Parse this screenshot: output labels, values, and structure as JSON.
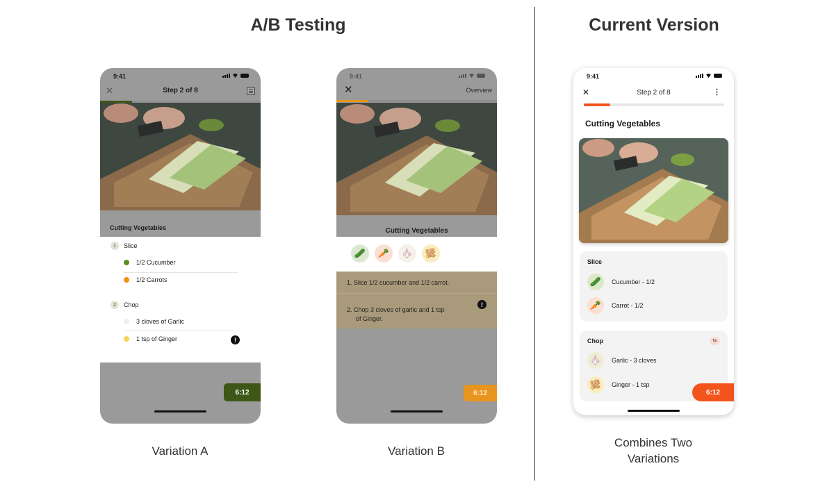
{
  "headings": {
    "ab": "A/B Testing",
    "current": "Current Version"
  },
  "captions": {
    "a": "Variation A",
    "b": "Variation B",
    "current_line1": "Combines Two",
    "current_line2": "Variations"
  },
  "colors": {
    "accent_orange": "#f2541b",
    "variation_a_green": "#3e5716",
    "variation_b_orange": "#e8951f",
    "dim_overlay": "#3c3c3c"
  },
  "variation_a": {
    "time": "9:41",
    "header_title": "Step 2 of 8",
    "section_title": "Cutting Vegetables",
    "steps": [
      {
        "number": "1",
        "label": "Slice",
        "items": [
          {
            "text": "1/2 Cucumber",
            "color": "#5a8f1f"
          },
          {
            "text": "1/2 Carrots",
            "color": "#f0900f"
          }
        ]
      },
      {
        "number": "2",
        "label": "Chop",
        "items": [
          {
            "text": "3 cloves of Garlic",
            "color": "#eeeeea"
          },
          {
            "text": "1 tsp of Ginger",
            "color": "#f7d35a"
          }
        ]
      }
    ],
    "tip_icon": "!",
    "timer": "6:12",
    "progress": 0.2
  },
  "variation_b": {
    "time": "9:41",
    "overview_label": "Overview",
    "section_title": "Cutting Vegetables",
    "ingredients": [
      {
        "icon": "cucumber-icon",
        "glyph": "🥒",
        "bg": "#dce8d2"
      },
      {
        "icon": "carrot-icon",
        "glyph": "🥕",
        "bg": "#fbded4"
      },
      {
        "icon": "garlic-icon",
        "glyph": "🧄",
        "bg": "#f5f1e8"
      },
      {
        "icon": "ginger-icon",
        "glyph": "🫚",
        "bg": "#fbecc0"
      }
    ],
    "instructions": [
      {
        "number": "1.",
        "text": "Slice 1/2 cucumber and 1/2 carrot."
      },
      {
        "number": "2.",
        "line1": "Chop 3 cloves of garlic and 1 tsp",
        "line2": "of Ginger."
      }
    ],
    "tip_icon": "!",
    "timer": "6:12",
    "progress": 0.2
  },
  "current": {
    "time": "9:41",
    "header_title": "Step 2 of 8",
    "section_title": "Cutting Vegetables",
    "progress": 0.19,
    "cards": [
      {
        "title": "Slice",
        "items": [
          {
            "text": "Cucumber - 1/2",
            "icon": "cucumber-icon",
            "glyph": "🥒",
            "bg": "#dbe9c9"
          },
          {
            "text": "Carrot - 1/2",
            "icon": "carrot-icon",
            "glyph": "🥕",
            "bg": "#fbded4"
          }
        ]
      },
      {
        "title": "Chop",
        "tip": "Tip",
        "items": [
          {
            "text": "Garlic - 3 cloves",
            "icon": "garlic-icon",
            "glyph": "🧄",
            "bg": "#efecd6"
          },
          {
            "text": "Ginger - 1 tsp",
            "icon": "ginger-icon",
            "glyph": "🫚",
            "bg": "#fbecc0"
          }
        ]
      }
    ],
    "timer": "6:12"
  }
}
